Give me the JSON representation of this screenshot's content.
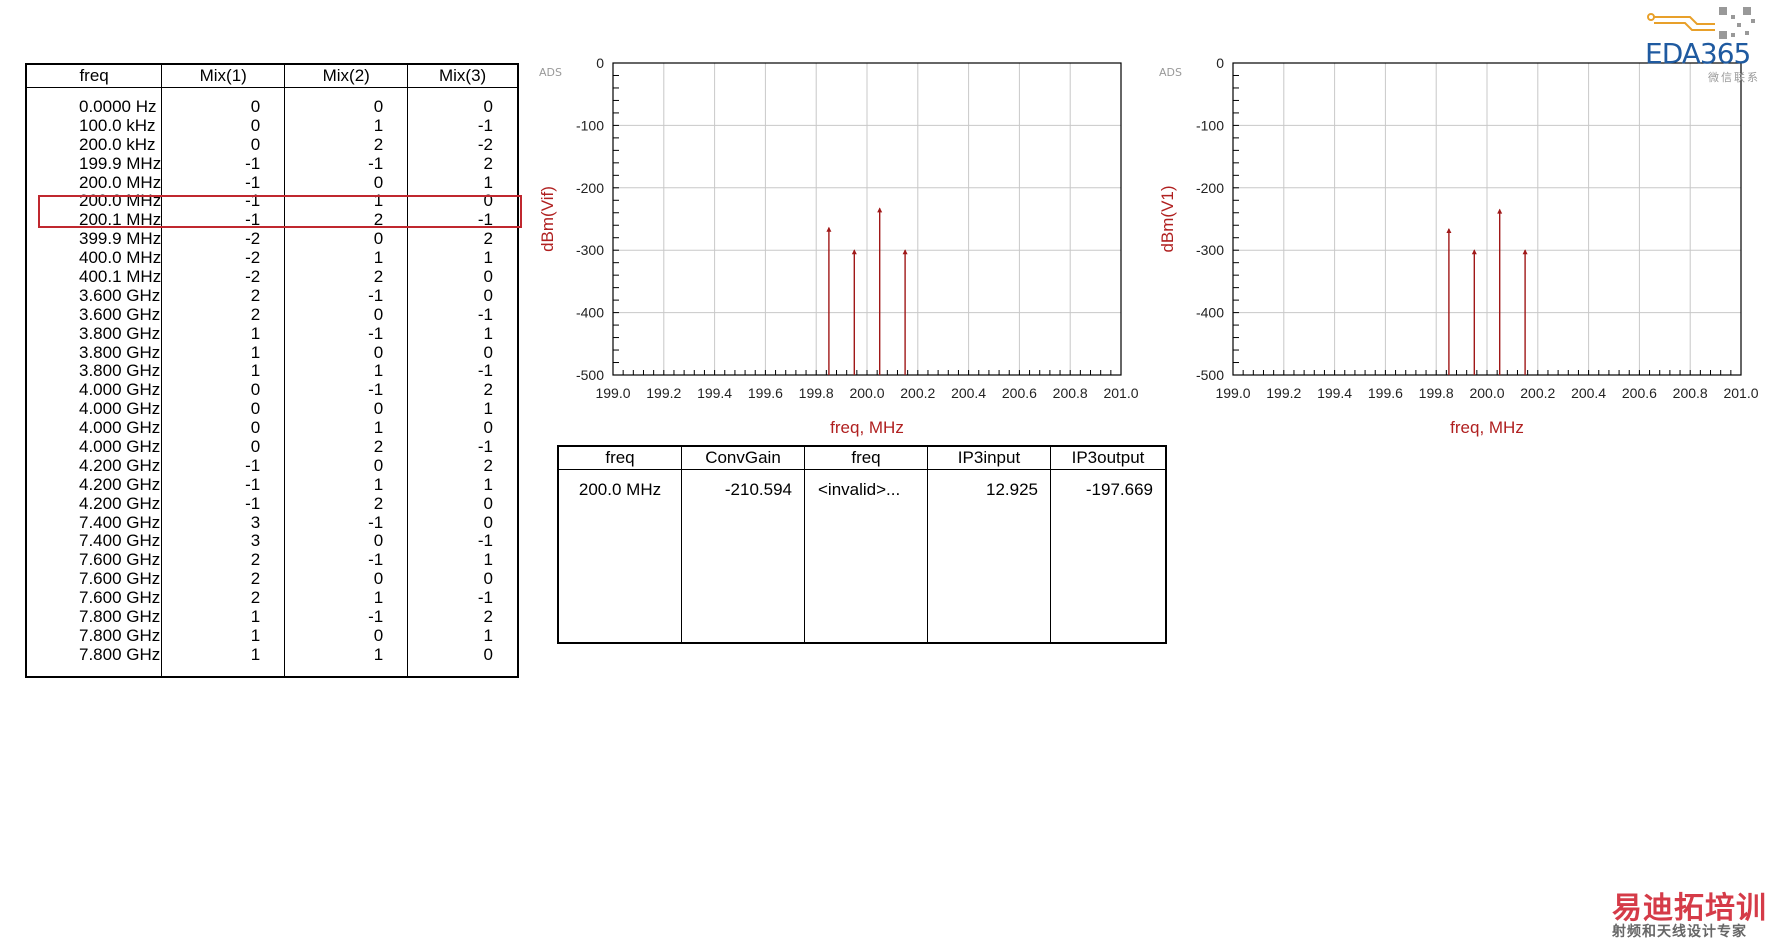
{
  "mix_table": {
    "headers": [
      "freq",
      "Mix(1)",
      "Mix(2)",
      "Mix(3)"
    ],
    "freq": [
      "0.0000 Hz",
      "100.0 kHz",
      "200.0 kHz",
      "199.9 MHz",
      "200.0 MHz",
      "200.0 MHz",
      "200.1 MHz",
      "399.9 MHz",
      "400.0 MHz",
      "400.1 MHz",
      "3.600 GHz",
      "3.600 GHz",
      "3.800 GHz",
      "3.800 GHz",
      "3.800 GHz",
      "4.000 GHz",
      "4.000 GHz",
      "4.000 GHz",
      "4.000 GHz",
      "4.200 GHz",
      "4.200 GHz",
      "4.200 GHz",
      "7.400 GHz",
      "7.400 GHz",
      "7.600 GHz",
      "7.600 GHz",
      "7.600 GHz",
      "7.800 GHz",
      "7.800 GHz",
      "7.800 GHz"
    ],
    "mix1": [
      "0",
      "0",
      "0",
      "-1",
      "-1",
      "-1",
      "-1",
      "-2",
      "-2",
      "-2",
      "2",
      "2",
      "1",
      "1",
      "1",
      "0",
      "0",
      "0",
      "0",
      "-1",
      "-1",
      "-1",
      "3",
      "3",
      "2",
      "2",
      "2",
      "1",
      "1",
      "1"
    ],
    "mix2": [
      "0",
      "1",
      "2",
      "-1",
      "0",
      "1",
      "2",
      "0",
      "1",
      "2",
      "-1",
      "0",
      "-1",
      "0",
      "1",
      "-1",
      "0",
      "1",
      "2",
      "0",
      "1",
      "2",
      "-1",
      "0",
      "-1",
      "0",
      "1",
      "-1",
      "0",
      "1"
    ],
    "mix3": [
      "0",
      "-1",
      "-2",
      "2",
      "1",
      "0",
      "-1",
      "2",
      "1",
      "0",
      "0",
      "-1",
      "1",
      "0",
      "-1",
      "2",
      "1",
      "0",
      "-1",
      "2",
      "1",
      "0",
      "0",
      "-1",
      "1",
      "0",
      "-1",
      "2",
      "1",
      "0"
    ]
  },
  "result_table": {
    "headers": [
      "freq",
      "ConvGain",
      "freq",
      "IP3input",
      "IP3output"
    ],
    "row": [
      "200.0 MHz",
      "-210.594",
      "<invalid>...",
      "12.925",
      "-197.669"
    ]
  },
  "chart_data": [
    {
      "type": "bar",
      "tag": "ADS",
      "xlabel": "freq, MHz",
      "ylabel": "dBm(Vif)",
      "xlim": [
        199.0,
        201.0
      ],
      "ylim": [
        -500,
        0
      ],
      "xticks": [
        "199.0",
        "199.2",
        "199.4",
        "199.6",
        "199.8",
        "200.0",
        "200.2",
        "200.4",
        "200.6",
        "200.8",
        "201.0"
      ],
      "yticks": [
        "0",
        "-100",
        "-200",
        "-300",
        "-400",
        "-500"
      ],
      "x": [
        199.85,
        199.95,
        200.05,
        200.15
      ],
      "y": [
        -264,
        -300,
        -233,
        -300
      ],
      "grid": true,
      "color": "#a01818"
    },
    {
      "type": "bar",
      "tag": "ADS",
      "xlabel": "freq, MHz",
      "ylabel": "dBm(V1)",
      "xlim": [
        199.0,
        201.0
      ],
      "ylim": [
        -500,
        0
      ],
      "xticks": [
        "199.0",
        "199.2",
        "199.4",
        "199.6",
        "199.8",
        "200.0",
        "200.2",
        "200.4",
        "200.6",
        "200.8",
        "201.0"
      ],
      "yticks": [
        "0",
        "-100",
        "-200",
        "-300",
        "-400",
        "-500"
      ],
      "x": [
        199.85,
        199.95,
        200.05,
        200.15
      ],
      "y": [
        -266,
        -300,
        -235,
        -300
      ],
      "grid": true,
      "color": "#a01818"
    }
  ],
  "logo": {
    "text": "EDA365",
    "sub": "微信联系"
  },
  "watermark": {
    "main": "易迪拓培训",
    "sub": "射频和天线设计专家"
  }
}
